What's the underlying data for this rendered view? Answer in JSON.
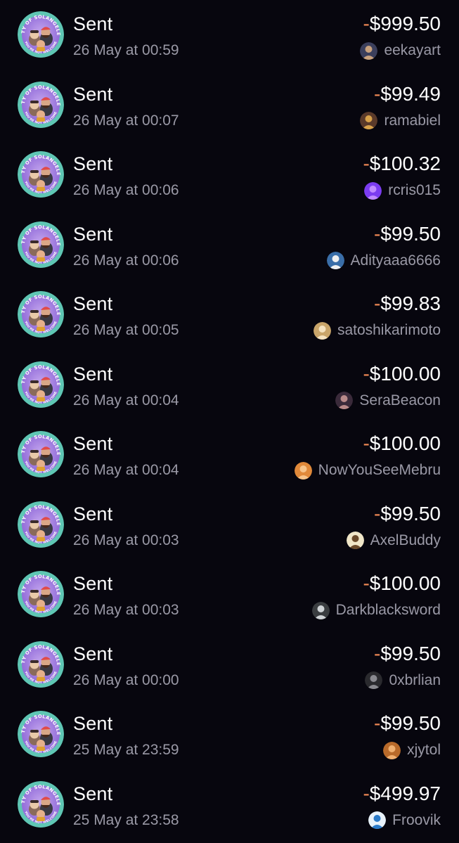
{
  "transactions": [
    {
      "type": "Sent",
      "date": "26 May at 00:59",
      "sign": "-",
      "amount": "$999.50",
      "username": "eekayart",
      "avatar_color": "#3b3f5c",
      "avatar_accent": "#c9a27e"
    },
    {
      "type": "Sent",
      "date": "26 May at 00:07",
      "sign": "-",
      "amount": "$99.49",
      "username": "ramabiel",
      "avatar_color": "#5a3a2a",
      "avatar_accent": "#d8a24a"
    },
    {
      "type": "Sent",
      "date": "26 May at 00:06",
      "sign": "-",
      "amount": "$100.32",
      "username": "rcris015",
      "avatar_color": "#7b3cf0",
      "avatar_accent": "#c08bff"
    },
    {
      "type": "Sent",
      "date": "26 May at 00:06",
      "sign": "-",
      "amount": "$99.50",
      "username": "Adityaaa6666",
      "avatar_color": "#3a6ea8",
      "avatar_accent": "#f0f0f0"
    },
    {
      "type": "Sent",
      "date": "26 May at 00:05",
      "sign": "-",
      "amount": "$99.83",
      "username": "satoshikarimoto",
      "avatar_color": "#c9a56a",
      "avatar_accent": "#f5e3c0"
    },
    {
      "type": "Sent",
      "date": "26 May at 00:04",
      "sign": "-",
      "amount": "$100.00",
      "username": "SeraBeacon",
      "avatar_color": "#3a2a3a",
      "avatar_accent": "#b98a8a"
    },
    {
      "type": "Sent",
      "date": "26 May at 00:04",
      "sign": "-",
      "amount": "$100.00",
      "username": "NowYouSeeMebru",
      "avatar_color": "#e0893a",
      "avatar_accent": "#f7c48a"
    },
    {
      "type": "Sent",
      "date": "26 May at 00:03",
      "sign": "-",
      "amount": "$99.50",
      "username": "AxelBuddy",
      "avatar_color": "#f0e6c8",
      "avatar_accent": "#6a4a2a"
    },
    {
      "type": "Sent",
      "date": "26 May at 00:03",
      "sign": "-",
      "amount": "$100.00",
      "username": "Darkblacksword",
      "avatar_color": "#3a3d40",
      "avatar_accent": "#cfd3d6"
    },
    {
      "type": "Sent",
      "date": "26 May at 00:00",
      "sign": "-",
      "amount": "$99.50",
      "username": "0xbrlian",
      "avatar_color": "#2a2a2e",
      "avatar_accent": "#8a8a90"
    },
    {
      "type": "Sent",
      "date": "25 May at 23:59",
      "sign": "-",
      "amount": "$99.50",
      "username": "xjytol",
      "avatar_color": "#b86a2a",
      "avatar_accent": "#f0b070"
    },
    {
      "type": "Sent",
      "date": "25 May at 23:58",
      "sign": "-",
      "amount": "$499.97",
      "username": "Froovik",
      "avatar_color": "#e8f2fa",
      "avatar_accent": "#2a7ac8"
    }
  ],
  "colors": {
    "background": "#07060e",
    "negative_sign": "#f28a55",
    "secondary_text": "#9a99a6"
  },
  "token_icon": "city-of-solangeles-logo-icon",
  "token_logo_text": {
    "top": "CITY OF SOLANGELES",
    "bottom": "YOU'RE NOT WELCOME"
  }
}
